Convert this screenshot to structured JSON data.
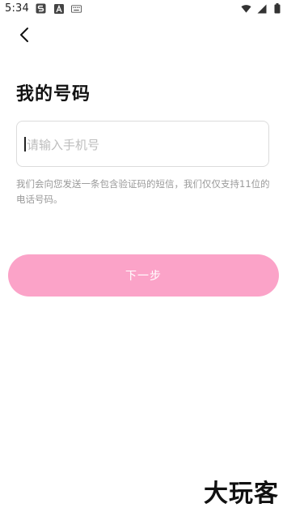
{
  "status_bar": {
    "time": "5:34",
    "notification_icons": [
      "s-app-icon",
      "a-app-icon",
      "keyboard-icon"
    ],
    "system_icons": [
      "wifi-icon",
      "signal-icon",
      "battery-icon"
    ]
  },
  "header": {
    "back_icon": "chevron-left-icon"
  },
  "page": {
    "title": "我的号码"
  },
  "phone_input": {
    "placeholder": "请输入手机号",
    "value": ""
  },
  "hint": {
    "text": "我们会向您发送一条包含验证码的短信，我们仅仅支持11位的电话号码。"
  },
  "actions": {
    "next_label": "下一步"
  },
  "watermark": {
    "text": "大玩客"
  },
  "colors": {
    "button_bg": "#fba3c8",
    "button_text": "#ffffff",
    "hint_text": "#9a9a9a",
    "placeholder": "#bdbdbd",
    "border": "#dcdcdc"
  }
}
